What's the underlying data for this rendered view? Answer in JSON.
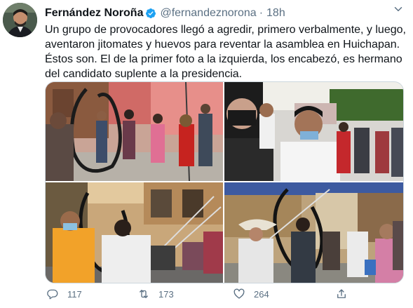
{
  "tweet": {
    "author_name": "Fernández Noroña",
    "handle": "@fernandeznorona",
    "separator": "·",
    "time": "18h",
    "text": "Un grupo de provocadores llegó a agredir, primero verbalmente, y luego, aventaron jitomates y huevos para reventar la asamblea en Huichapan. Éstos son. El de la primer foto a la izquierda, los encabezó, es hermano del candidato suplente a la presidencia.",
    "verified": true,
    "photos_count": 4
  },
  "actions": {
    "reply_icon": "reply-icon",
    "replies": "117",
    "retweet_icon": "retweet-icon",
    "retweets": "173",
    "like_icon": "heart-icon",
    "likes": "264",
    "share_icon": "share-icon"
  },
  "colors": {
    "text": "#0f1419",
    "secondary": "#5b7083",
    "verified": "#1da1f2",
    "border": "#ccd6dd"
  }
}
